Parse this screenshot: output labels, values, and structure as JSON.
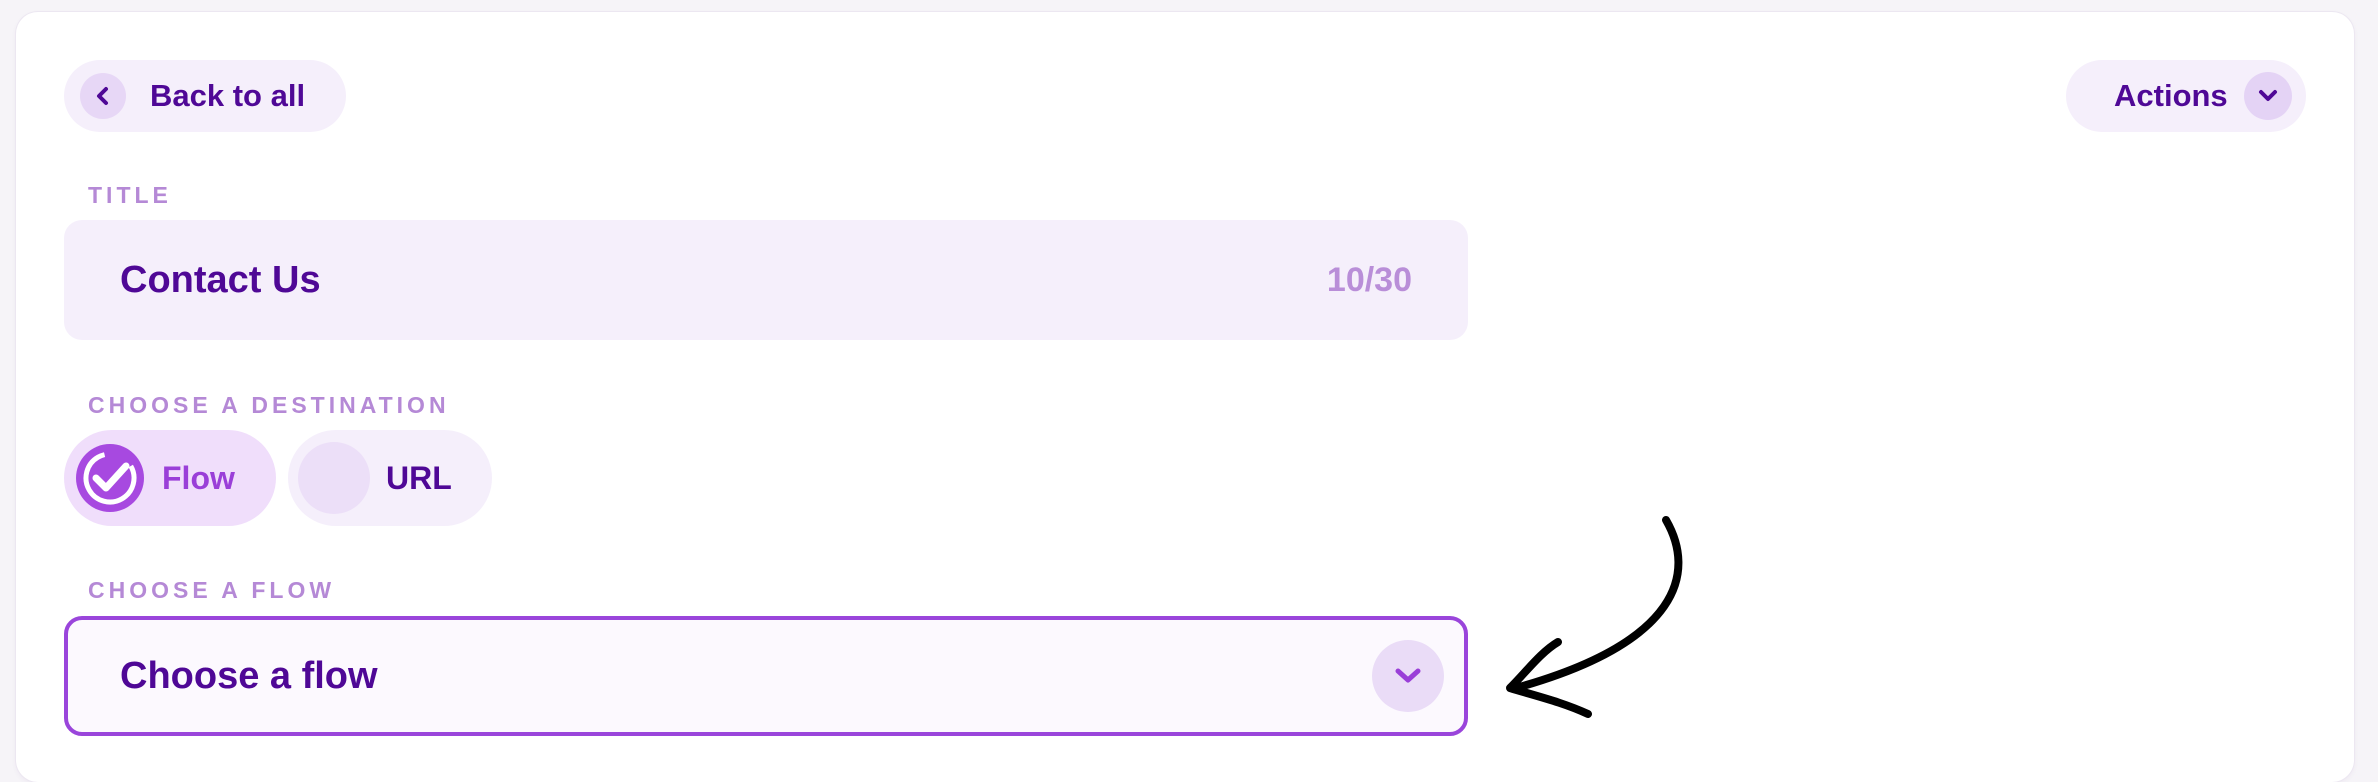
{
  "header": {
    "back_label": "Back to all",
    "actions_label": "Actions"
  },
  "title_section": {
    "label": "TITLE",
    "value": "Contact Us",
    "char_count": "10/30"
  },
  "destination_section": {
    "label": "CHOOSE A DESTINATION",
    "options": [
      {
        "label": "Flow",
        "selected": true
      },
      {
        "label": "URL",
        "selected": false
      }
    ]
  },
  "flow_section": {
    "label": "CHOOSE A FLOW",
    "placeholder": "Choose a flow"
  },
  "colors": {
    "primary_text": "#4f0896",
    "accent": "#9a45db",
    "label": "#b589d6",
    "pill_background": "#f5effb"
  },
  "icons": {
    "back": "chevron-left-icon",
    "actions": "chevron-down-icon",
    "flow_selected": "check-circle-icon",
    "select": "chevron-down-icon",
    "annotation": "hand-drawn-arrow-icon"
  }
}
